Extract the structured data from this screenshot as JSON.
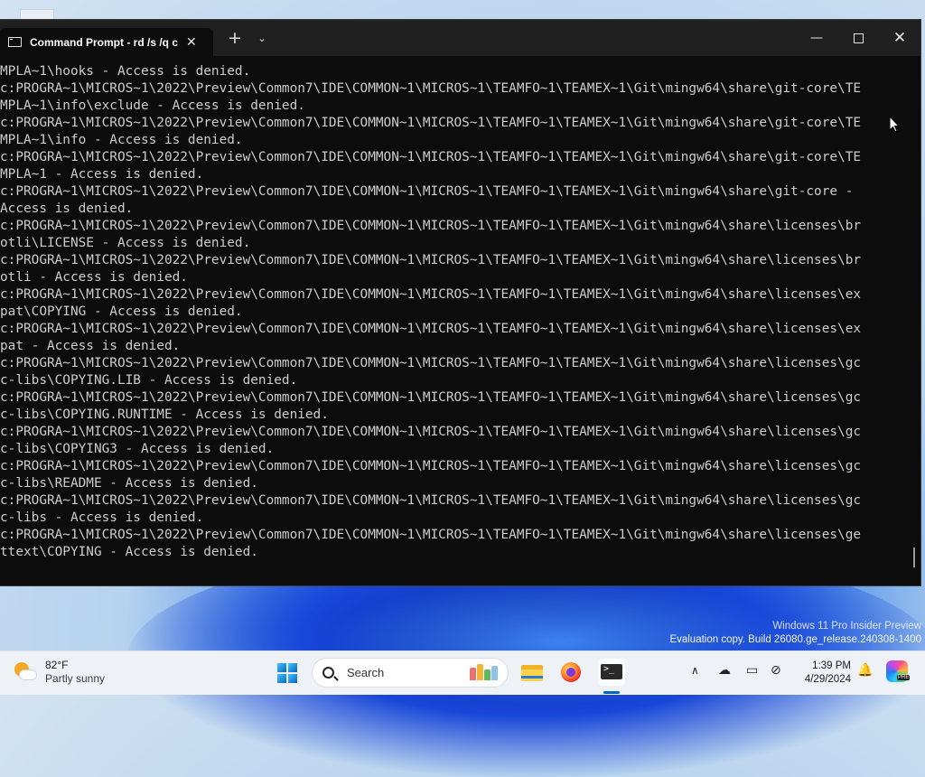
{
  "window": {
    "tab_title": "Command Prompt - rd  /s /q c",
    "tab_close": "✕",
    "new_tab": "+",
    "tab_menu": "⌄",
    "minimize": "—",
    "close": "✕"
  },
  "console": {
    "lines": [
      "MPLA~1\\hooks - Access is denied.",
      "c:PROGRA~1\\MICROS~1\\2022\\Preview\\Common7\\IDE\\COMMON~1\\MICROS~1\\TEAMFO~1\\TEAMEX~1\\Git\\mingw64\\share\\git-core\\TE",
      "MPLA~1\\info\\exclude - Access is denied.",
      "c:PROGRA~1\\MICROS~1\\2022\\Preview\\Common7\\IDE\\COMMON~1\\MICROS~1\\TEAMFO~1\\TEAMEX~1\\Git\\mingw64\\share\\git-core\\TE",
      "MPLA~1\\info - Access is denied.",
      "c:PROGRA~1\\MICROS~1\\2022\\Preview\\Common7\\IDE\\COMMON~1\\MICROS~1\\TEAMFO~1\\TEAMEX~1\\Git\\mingw64\\share\\git-core\\TE",
      "MPLA~1 - Access is denied.",
      "c:PROGRA~1\\MICROS~1\\2022\\Preview\\Common7\\IDE\\COMMON~1\\MICROS~1\\TEAMFO~1\\TEAMEX~1\\Git\\mingw64\\share\\git-core -",
      "Access is denied.",
      "c:PROGRA~1\\MICROS~1\\2022\\Preview\\Common7\\IDE\\COMMON~1\\MICROS~1\\TEAMFO~1\\TEAMEX~1\\Git\\mingw64\\share\\licenses\\br",
      "otli\\LICENSE - Access is denied.",
      "c:PROGRA~1\\MICROS~1\\2022\\Preview\\Common7\\IDE\\COMMON~1\\MICROS~1\\TEAMFO~1\\TEAMEX~1\\Git\\mingw64\\share\\licenses\\br",
      "otli - Access is denied.",
      "c:PROGRA~1\\MICROS~1\\2022\\Preview\\Common7\\IDE\\COMMON~1\\MICROS~1\\TEAMFO~1\\TEAMEX~1\\Git\\mingw64\\share\\licenses\\ex",
      "pat\\COPYING - Access is denied.",
      "c:PROGRA~1\\MICROS~1\\2022\\Preview\\Common7\\IDE\\COMMON~1\\MICROS~1\\TEAMFO~1\\TEAMEX~1\\Git\\mingw64\\share\\licenses\\ex",
      "pat - Access is denied.",
      "c:PROGRA~1\\MICROS~1\\2022\\Preview\\Common7\\IDE\\COMMON~1\\MICROS~1\\TEAMFO~1\\TEAMEX~1\\Git\\mingw64\\share\\licenses\\gc",
      "c-libs\\COPYING.LIB - Access is denied.",
      "c:PROGRA~1\\MICROS~1\\2022\\Preview\\Common7\\IDE\\COMMON~1\\MICROS~1\\TEAMFO~1\\TEAMEX~1\\Git\\mingw64\\share\\licenses\\gc",
      "c-libs\\COPYING.RUNTIME - Access is denied.",
      "c:PROGRA~1\\MICROS~1\\2022\\Preview\\Common7\\IDE\\COMMON~1\\MICROS~1\\TEAMFO~1\\TEAMEX~1\\Git\\mingw64\\share\\licenses\\gc",
      "c-libs\\COPYING3 - Access is denied.",
      "c:PROGRA~1\\MICROS~1\\2022\\Preview\\Common7\\IDE\\COMMON~1\\MICROS~1\\TEAMFO~1\\TEAMEX~1\\Git\\mingw64\\share\\licenses\\gc",
      "c-libs\\README - Access is denied.",
      "c:PROGRA~1\\MICROS~1\\2022\\Preview\\Common7\\IDE\\COMMON~1\\MICROS~1\\TEAMFO~1\\TEAMEX~1\\Git\\mingw64\\share\\licenses\\gc",
      "c-libs - Access is denied.",
      "c:PROGRA~1\\MICROS~1\\2022\\Preview\\Common7\\IDE\\COMMON~1\\MICROS~1\\TEAMFO~1\\TEAMEX~1\\Git\\mingw64\\share\\licenses\\ge",
      "ttext\\COPYING - Access is denied."
    ]
  },
  "watermark": {
    "line1": "Windows 11 Pro Insider Preview",
    "line2": "Evaluation copy. Build 26080.ge_release.240308-1400"
  },
  "taskbar": {
    "weather_temp": "82°F",
    "weather_condition": "Partly sunny",
    "search_label": "Search",
    "time": "1:39 PM",
    "date": "4/29/2024",
    "tray_chevron": "∧",
    "cloud": "☁",
    "monitor": "▭",
    "netvol": "⊘",
    "bell": "🔔",
    "copilot_badge": "PRE"
  },
  "colors": {
    "terminal_bg": "#0c0c0c",
    "console_text": "#cccccc",
    "titlebar": "#202020",
    "accent": "#0067c0"
  },
  "icons": [
    "cmd-icon",
    "search-icon",
    "start-icon",
    "file-explorer-icon",
    "firefox-icon",
    "terminal-icon",
    "weather-icon",
    "copilot-icon"
  ]
}
